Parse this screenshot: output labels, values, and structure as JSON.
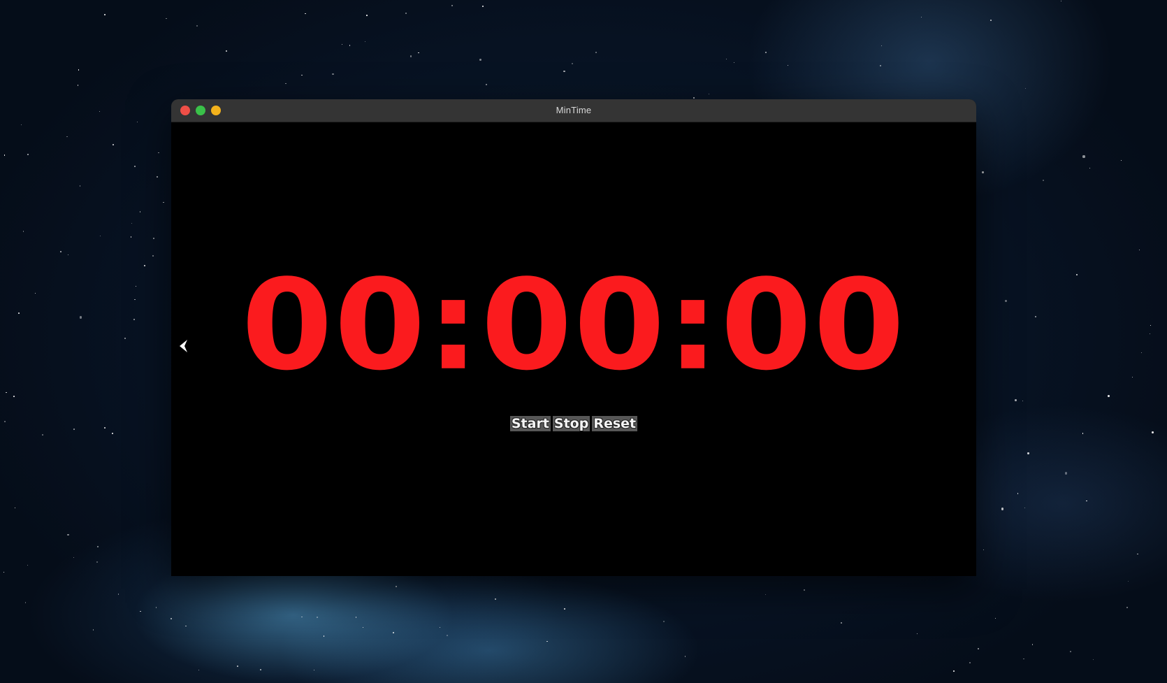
{
  "window": {
    "title": "MinTime"
  },
  "timer": {
    "display": "00:00:00",
    "color": "#fb1b1e"
  },
  "controls": {
    "start_label": "Start",
    "stop_label": "Stop",
    "reset_label": "Reset"
  },
  "icons": {
    "back": "chevron-left-icon"
  },
  "colors": {
    "close": "#ef4f47",
    "maximize": "#3ac149",
    "minimize": "#f3b21c",
    "titlebar": "#343434",
    "content_bg": "#000000"
  }
}
